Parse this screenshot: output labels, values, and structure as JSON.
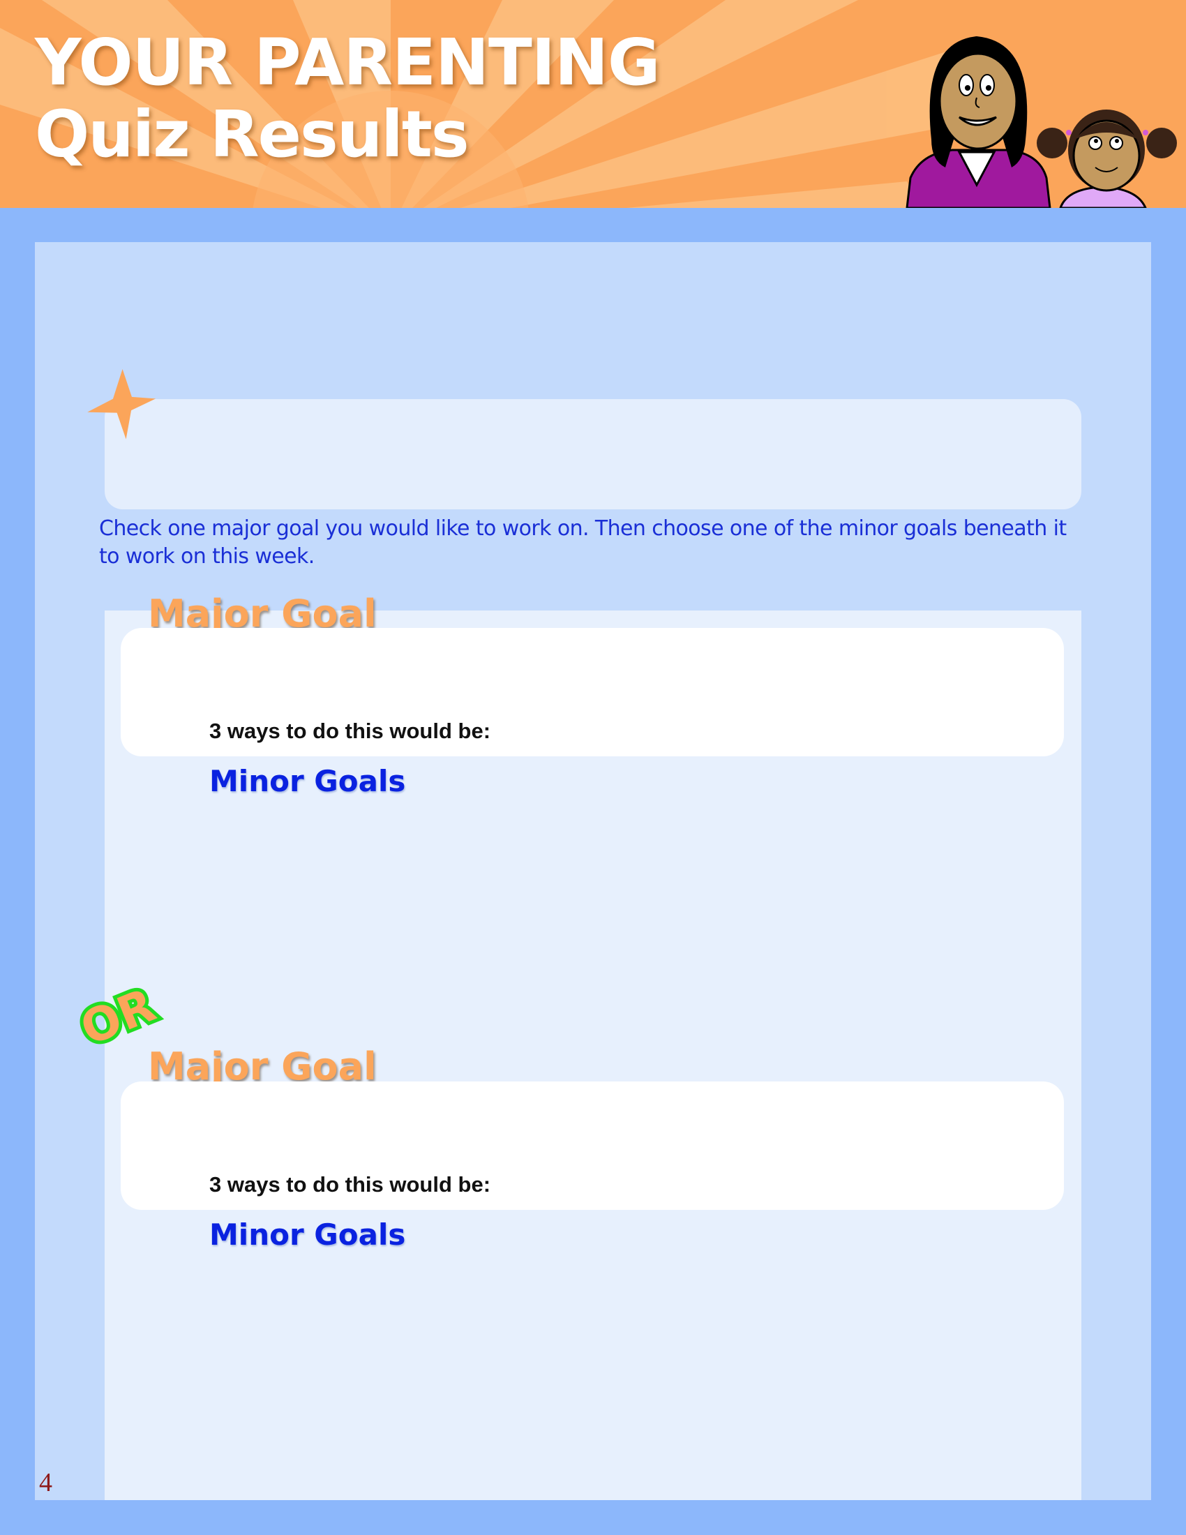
{
  "header": {
    "title_line1": "YOUR PARENTING",
    "title_line2": "Quiz Results",
    "illustration": "mother-and-daughter-illustration"
  },
  "colors": {
    "header_orange": "#fba55a",
    "frame_blue": "#8cb7fb",
    "panel_blue": "#c3dafc",
    "instruction_blue": "#1a2fd6",
    "minor_goals_blue": "#0a22e0",
    "or_green": "#22dd22"
  },
  "icons": {
    "star": "star-icon",
    "or_badge": "or-badge"
  },
  "instructions": "Check one major goal you would like to work on. Then choose one of the minor goals beneath it to work on this week.",
  "goal_sections": [
    {
      "major_title": "Major Goal",
      "ways_label": "3 ways to do this would be:",
      "minor_title": "Minor Goals"
    },
    {
      "major_title": "Major Goal",
      "ways_label": "3 ways to do this would be:",
      "minor_title": "Minor Goals"
    }
  ],
  "or_label": "OR",
  "page_number": "4"
}
